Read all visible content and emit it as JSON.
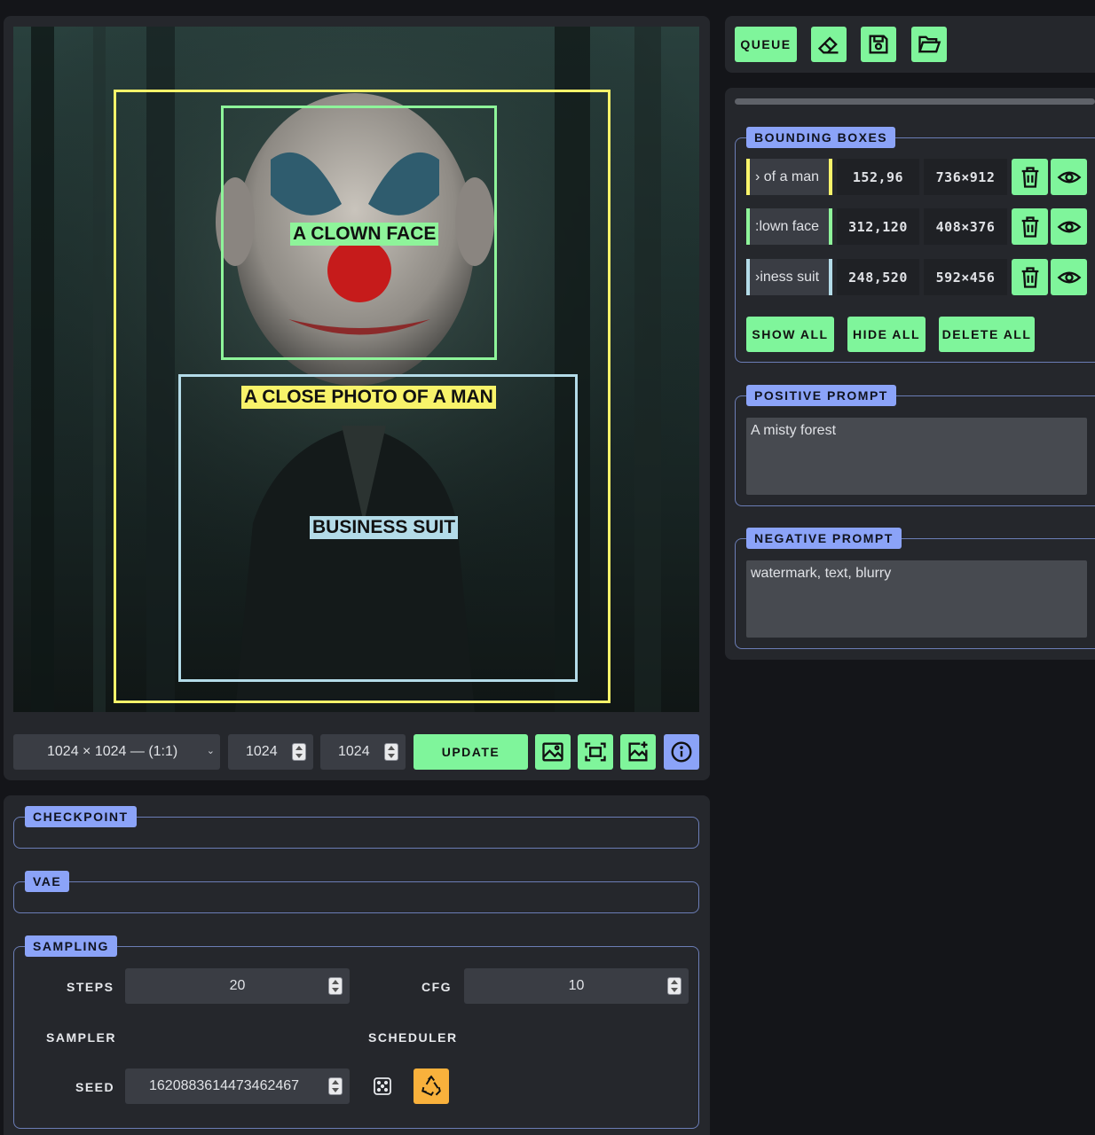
{
  "canvas": {
    "boxes": [
      {
        "label": "A close photo of a man",
        "color": "#f8f36a"
      },
      {
        "label": "A clown face",
        "color": "#8ef49a"
      },
      {
        "label": "business suit",
        "color": "#b3dbe8"
      }
    ],
    "tag_texts": [
      "A CLOWN FACE",
      "A CLOSE PHOTO OF A MAN",
      "BUSINESS SUIT"
    ]
  },
  "size_controls": {
    "aspect_select": "1024 × 1024 — (1:1)",
    "width": "1024",
    "height": "1024",
    "update_label": "UPDATE"
  },
  "toolbar": {
    "queue_label": "QUEUE"
  },
  "bounding_boxes": {
    "legend": "BOUNDING BOXES",
    "rows": [
      {
        "label_visible": "› of a man",
        "pos": "152,96",
        "size": "736×912",
        "color": "#f8f36a"
      },
      {
        "label_visible": ":lown face",
        "pos": "312,120",
        "size": "408×376",
        "color": "#8ef49a"
      },
      {
        "label_visible": "›iness suit",
        "pos": "248,520",
        "size": "592×456",
        "color": "#b3dbe8"
      }
    ],
    "show_all": "SHOW ALL",
    "hide_all": "HIDE ALL",
    "delete_all": "DELETE ALL"
  },
  "positive_prompt": {
    "legend": "POSITIVE PROMPT",
    "value": "A misty forest"
  },
  "negative_prompt": {
    "legend": "NEGATIVE PROMPT",
    "value": "watermark, text, blurry"
  },
  "checkpoint": {
    "legend": "CHECKPOINT"
  },
  "vae": {
    "legend": "VAE"
  },
  "sampling": {
    "legend": "SAMPLING",
    "steps_label": "STEPS",
    "steps": "20",
    "cfg_label": "CFG",
    "cfg": "10",
    "sampler_label": "SAMPLER",
    "scheduler_label": "SCHEDULER",
    "seed_label": "SEED",
    "seed": "1620883614473462467"
  },
  "colors": {
    "accent_green": "#7ff59b",
    "accent_blue": "#8ba3f8",
    "accent_orange": "#f9b13c"
  },
  "icons": [
    "eraser-icon",
    "save-icon",
    "folder-open-icon",
    "image-icon",
    "fit-screen-icon",
    "image-add-icon",
    "info-icon",
    "trash-icon",
    "eye-icon",
    "dice-icon",
    "recycle-icon"
  ]
}
